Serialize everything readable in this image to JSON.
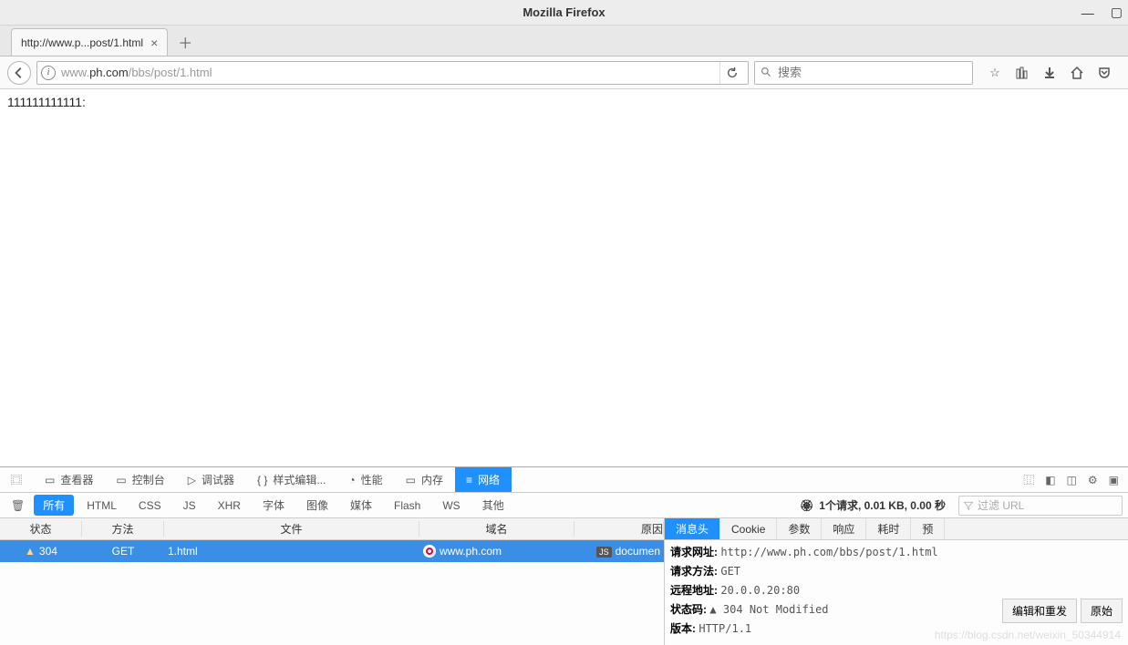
{
  "titlebar": {
    "title": "Mozilla Firefox"
  },
  "tab": {
    "label": "http://www.p...post/1.html"
  },
  "url": {
    "pre": "www.",
    "bold": "ph.com",
    "post": "/bbs/post/1.html"
  },
  "search": {
    "placeholder": "搜索"
  },
  "page": {
    "text": "111111111111:"
  },
  "devtools": {
    "tools": {
      "picker": "",
      "inspector": "查看器",
      "console": "控制台",
      "debugger": "调试器",
      "styles": "样式编辑...",
      "perf": "性能",
      "memory": "内存",
      "network": "网络"
    },
    "filters": {
      "all": "所有",
      "html": "HTML",
      "css": "CSS",
      "js": "JS",
      "xhr": "XHR",
      "fonts": "字体",
      "images": "图像",
      "media": "媒体",
      "flash": "Flash",
      "ws": "WS",
      "other": "其他"
    },
    "summary": "1个请求, 0.01 KB, 0.00 秒",
    "filter_placeholder": "过滤 URL",
    "columns": {
      "status": "状态",
      "method": "方法",
      "file": "文件",
      "domain": "域名",
      "cause": "原因"
    },
    "row": {
      "status": "304",
      "method": "GET",
      "file": "1.html",
      "domain": "www.ph.com",
      "cause": "documen"
    },
    "detail_tabs": {
      "headers": "消息头",
      "cookies": "Cookie",
      "params": "参数",
      "response": "响应",
      "timings": "耗时",
      "preview": "预"
    },
    "details": {
      "url_label": "请求网址:",
      "url_val": "http://www.ph.com/bbs/post/1.html",
      "method_label": "请求方法:",
      "method_val": "GET",
      "remote_label": "远程地址:",
      "remote_val": "20.0.0.20:80",
      "status_label": "状态码:",
      "status_val": "304 Not Modified",
      "version_label": "版本:",
      "version_val": "HTTP/1.1"
    },
    "buttons": {
      "edit": "编辑和重发",
      "raw": "原始"
    },
    "watermark": "https://blog.csdn.net/weixin_50344914"
  }
}
